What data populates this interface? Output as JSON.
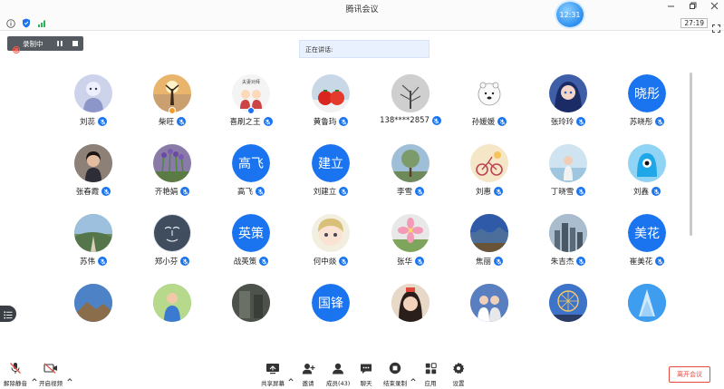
{
  "window": {
    "title": "腾讯会议"
  },
  "clock_bubble": "12:31",
  "meeting_duration": "27:19",
  "recording": {
    "label": "录制中"
  },
  "speaking_banner": "正在讲话:",
  "participants": [
    {
      "name": "刘蕊",
      "mic": true,
      "avatar": {
        "kind": "photo",
        "icon": "anime-figure",
        "bg": "#cdd3ea"
      }
    },
    {
      "name": "柴旺",
      "mic": true,
      "badge": "orange",
      "avatar": {
        "kind": "photo",
        "icon": "sunset-silhouette",
        "bg": "#e9b56c"
      }
    },
    {
      "name": "喜刷之王",
      "mic": true,
      "mic_gray": true,
      "badge": "blue",
      "avatar": {
        "kind": "photo",
        "icon": "couple-cartoon",
        "bg": "#f4f4f4"
      }
    },
    {
      "name": "黄鲁玙",
      "mic": true,
      "avatar": {
        "kind": "photo",
        "icon": "tomatoes",
        "bg": "#c9d8e6"
      }
    },
    {
      "name": "138****2857",
      "mic": true,
      "avatar": {
        "kind": "photo",
        "icon": "snow-tree",
        "bg": "#b7b7b7"
      }
    },
    {
      "name": "孙媛媛",
      "mic": true,
      "avatar": {
        "kind": "photo",
        "icon": "white-bear",
        "bg": "#ffffff"
      }
    },
    {
      "name": "张玲玲",
      "mic": true,
      "avatar": {
        "kind": "photo",
        "icon": "anime-girl",
        "bg": "#3e5ea8"
      }
    },
    {
      "name": "苏晓彤",
      "mic": true,
      "avatar": {
        "kind": "text",
        "text": "晓彤"
      }
    },
    {
      "name": "张春霞",
      "mic": true,
      "avatar": {
        "kind": "photo",
        "icon": "woman-portrait",
        "bg": "#a89a8c"
      }
    },
    {
      "name": "齐艳娟",
      "mic": true,
      "avatar": {
        "kind": "photo",
        "icon": "purple-flowers",
        "bg": "#8a7aa8"
      }
    },
    {
      "name": "高飞",
      "mic": true,
      "avatar": {
        "kind": "text",
        "text": "高飞"
      }
    },
    {
      "name": "刘建立",
      "mic": true,
      "avatar": {
        "kind": "text",
        "text": "建立"
      }
    },
    {
      "name": "李雪",
      "mic": true,
      "avatar": {
        "kind": "photo",
        "icon": "tree-sky",
        "bg": "#9fbfd8"
      }
    },
    {
      "name": "刘惠",
      "mic": true,
      "avatar": {
        "kind": "photo",
        "icon": "bicycle",
        "bg": "#f5e6c8"
      }
    },
    {
      "name": "丁晓雪",
      "mic": true,
      "avatar": {
        "kind": "photo",
        "icon": "girl-beach",
        "bg": "#cfe3f0"
      }
    },
    {
      "name": "刘鑫",
      "mic": true,
      "avatar": {
        "kind": "photo",
        "icon": "cyan-monster",
        "bg": "#8fd3f5"
      }
    },
    {
      "name": "苏伟",
      "mic": true,
      "avatar": {
        "kind": "photo",
        "icon": "hill-road",
        "bg": "#6f8c63"
      }
    },
    {
      "name": "郑小芬",
      "mic": true,
      "avatar": {
        "kind": "photo",
        "icon": "sketch-face",
        "bg": "#dfe6ee"
      }
    },
    {
      "name": "战英策",
      "mic": true,
      "avatar": {
        "kind": "text",
        "text": "英策"
      }
    },
    {
      "name": "何中燚",
      "mic": true,
      "avatar": {
        "kind": "photo",
        "icon": "anime-chibi",
        "bg": "#f2eee0"
      }
    },
    {
      "name": "张华",
      "mic": true,
      "avatar": {
        "kind": "photo",
        "icon": "pink-flower",
        "bg": "#e8e8e8"
      }
    },
    {
      "name": "焦丽",
      "mic": true,
      "avatar": {
        "kind": "photo",
        "icon": "blue-landscape",
        "bg": "#3f6db5"
      }
    },
    {
      "name": "朱吉杰",
      "mic": true,
      "avatar": {
        "kind": "photo",
        "icon": "city-skyline",
        "bg": "#7f9ab0"
      }
    },
    {
      "name": "崔美花",
      "mic": true,
      "avatar": {
        "kind": "text",
        "text": "美花"
      }
    },
    {
      "name": "",
      "mic": false,
      "avatar": {
        "kind": "photo",
        "icon": "mountain-sky",
        "bg": "#4d83c6"
      }
    },
    {
      "name": "",
      "mic": false,
      "avatar": {
        "kind": "photo",
        "icon": "child-green",
        "bg": "#7fb35a"
      }
    },
    {
      "name": "",
      "mic": false,
      "avatar": {
        "kind": "photo",
        "icon": "dark-portrait",
        "bg": "#5c625a"
      }
    },
    {
      "name": "",
      "mic": false,
      "avatar": {
        "kind": "text",
        "text": "国锋"
      }
    },
    {
      "name": "",
      "mic": false,
      "avatar": {
        "kind": "photo",
        "icon": "girl-face",
        "bg": "#d8b49a"
      }
    },
    {
      "name": "",
      "mic": false,
      "avatar": {
        "kind": "photo",
        "icon": "two-people",
        "bg": "#5a7fc0"
      }
    },
    {
      "name": "",
      "mic": false,
      "avatar": {
        "kind": "photo",
        "icon": "ferris-wheel",
        "bg": "#3d73c8"
      }
    },
    {
      "name": "",
      "mic": false,
      "avatar": {
        "kind": "photo",
        "icon": "ice-blue",
        "bg": "#2f86e0"
      }
    }
  ],
  "toolbar": {
    "unmute": "解除静音",
    "start_video": "开启视频",
    "share_screen": "共享屏幕",
    "invite": "邀请",
    "members": "成员(43)",
    "chat": "聊天",
    "end_recording": "结束录制",
    "apps": "应用",
    "settings": "设置",
    "leave": "离开会议"
  },
  "colors": {
    "accent": "#1a74ef",
    "leave": "#e54d42",
    "recbar": "#555a60"
  }
}
